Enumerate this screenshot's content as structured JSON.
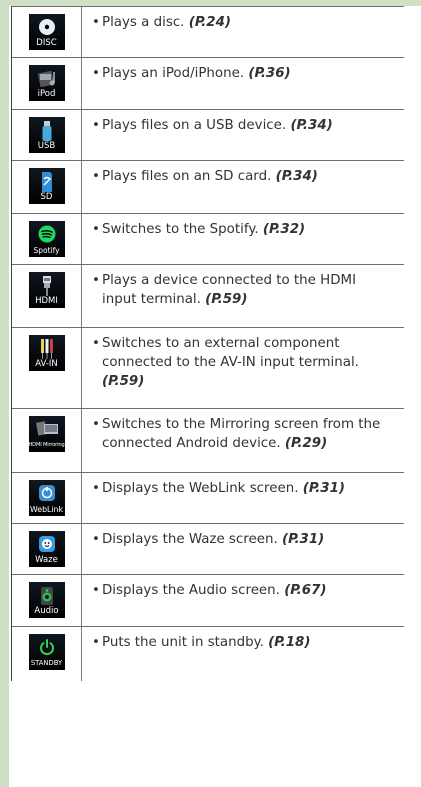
{
  "rows": [
    {
      "icon_name": "disc-icon",
      "label": "DISC",
      "text": "Plays a disc.",
      "ref": "(P.24)"
    },
    {
      "icon_name": "ipod-icon",
      "label": "iPod",
      "text": "Plays an iPod/iPhone.",
      "ref": "(P.36)"
    },
    {
      "icon_name": "usb-icon",
      "label": "USB",
      "text": "Plays files on a USB device.",
      "ref": "(P.34)"
    },
    {
      "icon_name": "sd-card-icon",
      "label": "SD",
      "text": "Plays files on an SD card.",
      "ref": "(P.34)"
    },
    {
      "icon_name": "spotify-icon",
      "label": "Spotify",
      "text": "Switches to the Spotify.",
      "ref": "(P.32)"
    },
    {
      "icon_name": "hdmi-icon",
      "label": "HDMI",
      "text": "Plays a device connected to the HDMI input terminal.",
      "ref": "(P.59)"
    },
    {
      "icon_name": "av-in-icon",
      "label": "AV-IN",
      "text": "Switches to an external component connected to the AV-IN input terminal.",
      "ref": "(P.59)"
    },
    {
      "icon_name": "hdmi-mirroring-icon",
      "label": "HDMI Mirroring",
      "text": "Switches to the Mirroring screen from the connected Android device.",
      "ref": "(P.29)"
    },
    {
      "icon_name": "weblink-icon",
      "label": "WebLink",
      "text": "Displays the WebLink screen.",
      "ref": "(P.31)"
    },
    {
      "icon_name": "waze-icon",
      "label": "Waze",
      "text": "Displays the Waze screen.",
      "ref": "(P.31)"
    },
    {
      "icon_name": "audio-icon",
      "label": "Audio",
      "text": "Displays the Audio screen.",
      "ref": "(P.67)"
    },
    {
      "icon_name": "standby-icon",
      "label": "STANDBY",
      "text": "Puts the unit in standby.",
      "ref": "(P.18)"
    }
  ],
  "bullet": "•",
  "colors": {
    "sidebar": "#cfe0c6",
    "icon_bg": "#000000",
    "text": "#333333"
  }
}
